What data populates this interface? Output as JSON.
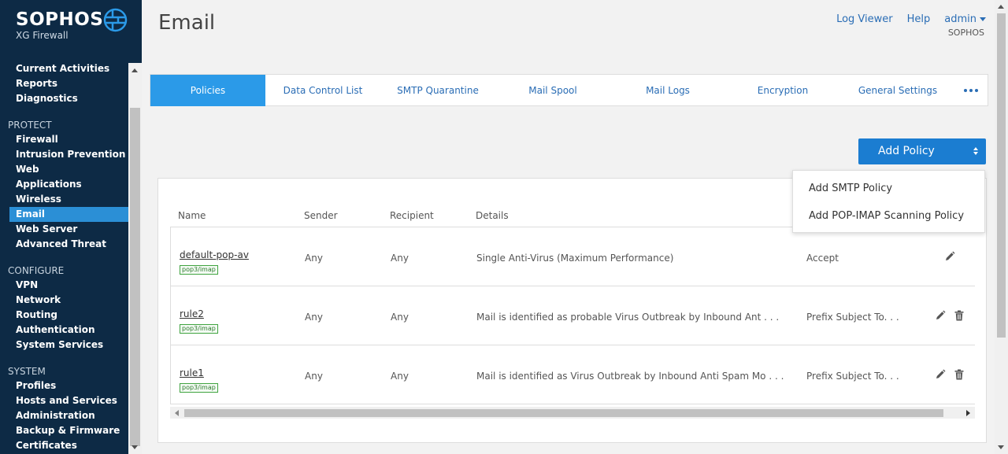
{
  "brand": {
    "name": "SOPHOS",
    "product": "XG Firewall",
    "icon": "globe-icon"
  },
  "sidebar": {
    "monitor_items": [
      "Current Activities",
      "Reports",
      "Diagnostics"
    ],
    "protect_label": "PROTECT",
    "protect_items": [
      "Firewall",
      "Intrusion Prevention",
      "Web",
      "Applications",
      "Wireless",
      "Email",
      "Web Server",
      "Advanced Threat"
    ],
    "configure_label": "CONFIGURE",
    "configure_items": [
      "VPN",
      "Network",
      "Routing",
      "Authentication",
      "System Services"
    ],
    "system_label": "SYSTEM",
    "system_items": [
      "Profiles",
      "Hosts and Services",
      "Administration",
      "Backup & Firmware",
      "Certificates"
    ],
    "active_item": "Email"
  },
  "header": {
    "title": "Email",
    "log_viewer": "Log Viewer",
    "help": "Help",
    "user": "admin",
    "org": "SOPHOS"
  },
  "tabs": [
    "Policies",
    "Data Control List",
    "SMTP Quarantine",
    "Mail Spool",
    "Mail Logs",
    "Encryption",
    "General Settings"
  ],
  "active_tab": "Policies",
  "add_button": {
    "label": "Add Policy"
  },
  "dropdown": {
    "items": [
      "Add SMTP Policy",
      "Add POP-IMAP Scanning Policy"
    ]
  },
  "table": {
    "columns": {
      "name": "Name",
      "sender": "Sender",
      "recipient": "Recipient",
      "details": "Details"
    },
    "rows": [
      {
        "name": "default-pop-av",
        "tag": "pop3/imap",
        "sender": "Any",
        "recipient": "Any",
        "details": "Single Anti-Virus (Maximum Performance)",
        "action": "Accept",
        "deletable": false
      },
      {
        "name": "rule2",
        "tag": "pop3/imap",
        "sender": "Any",
        "recipient": "Any",
        "details": "Mail is identified as probable Virus Outbreak by Inbound Ant . . .",
        "action": "Prefix Subject To. . .",
        "deletable": true
      },
      {
        "name": "rule1",
        "tag": "pop3/imap",
        "sender": "Any",
        "recipient": "Any",
        "details": "Mail is identified as Virus Outbreak by Inbound Anti Spam Mo . . .",
        "action": "Prefix Subject To. . .",
        "deletable": true
      }
    ]
  },
  "colors": {
    "sidebar_bg": "#0d2a45",
    "accent": "#2b9ae8",
    "button": "#1b7dd1",
    "link": "#2a6db5"
  }
}
